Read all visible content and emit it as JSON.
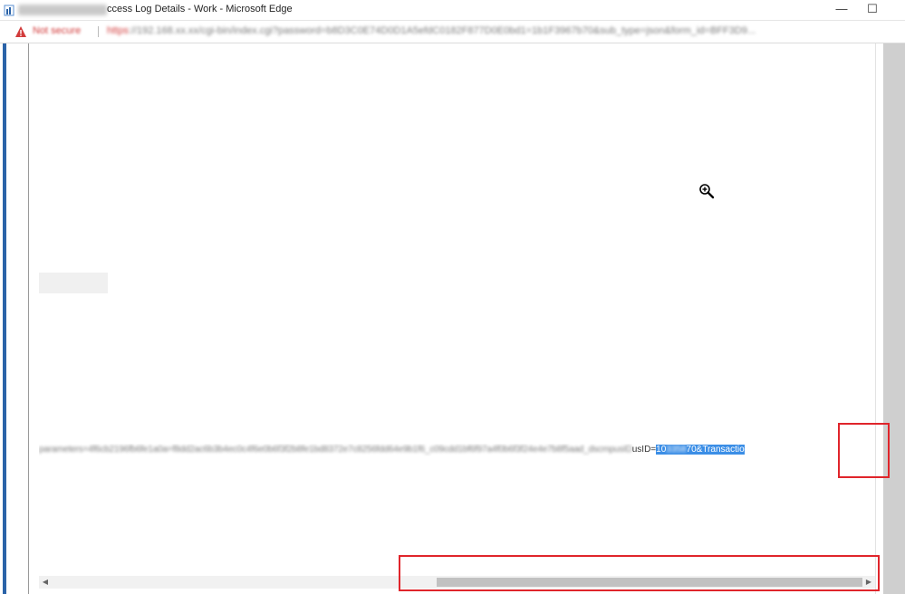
{
  "window": {
    "title": "Success Log Details - Work - Microsoft Edge",
    "title_visible_suffix": "ccess Log Details - Work - Microsoft Edge",
    "minimize_label": "—",
    "maximize_label": "☐"
  },
  "addressbar": {
    "security_label": "Not secure",
    "url_scheme": "https",
    "url_rest": "://192.168.xx.xx/cgi-bin/index.cgi?password=b8D3C0E74D0D1A5efdC0182F877D0E0bd1=1b1F3967b70&sub_type=json&form_id=BFF3D9..."
  },
  "content": {
    "url_text_blurred": "parameters=4f6cb2196fb6fe1a0a=f8dd2ac6b3b4ec0c4f6e0b6f3f2b8fe1bd8372e7c8256fdd64e9b1f6_c09cdd1bf6f97a4f0b6f3f24e4e7b8f5aad_dscmpusID",
    "url_text_plain": "usID=",
    "selected_text_start": "10",
    "selected_text_blurred": "3358",
    "selected_text_end": "70&Transactio"
  },
  "colors": {
    "annotation": "#e0252b",
    "selection": "#3b8ee6",
    "not_secure": "#d23b3b"
  },
  "icons": {
    "cursor": "zoom-in-cursor-icon",
    "warning": "warning-triangle-icon"
  }
}
